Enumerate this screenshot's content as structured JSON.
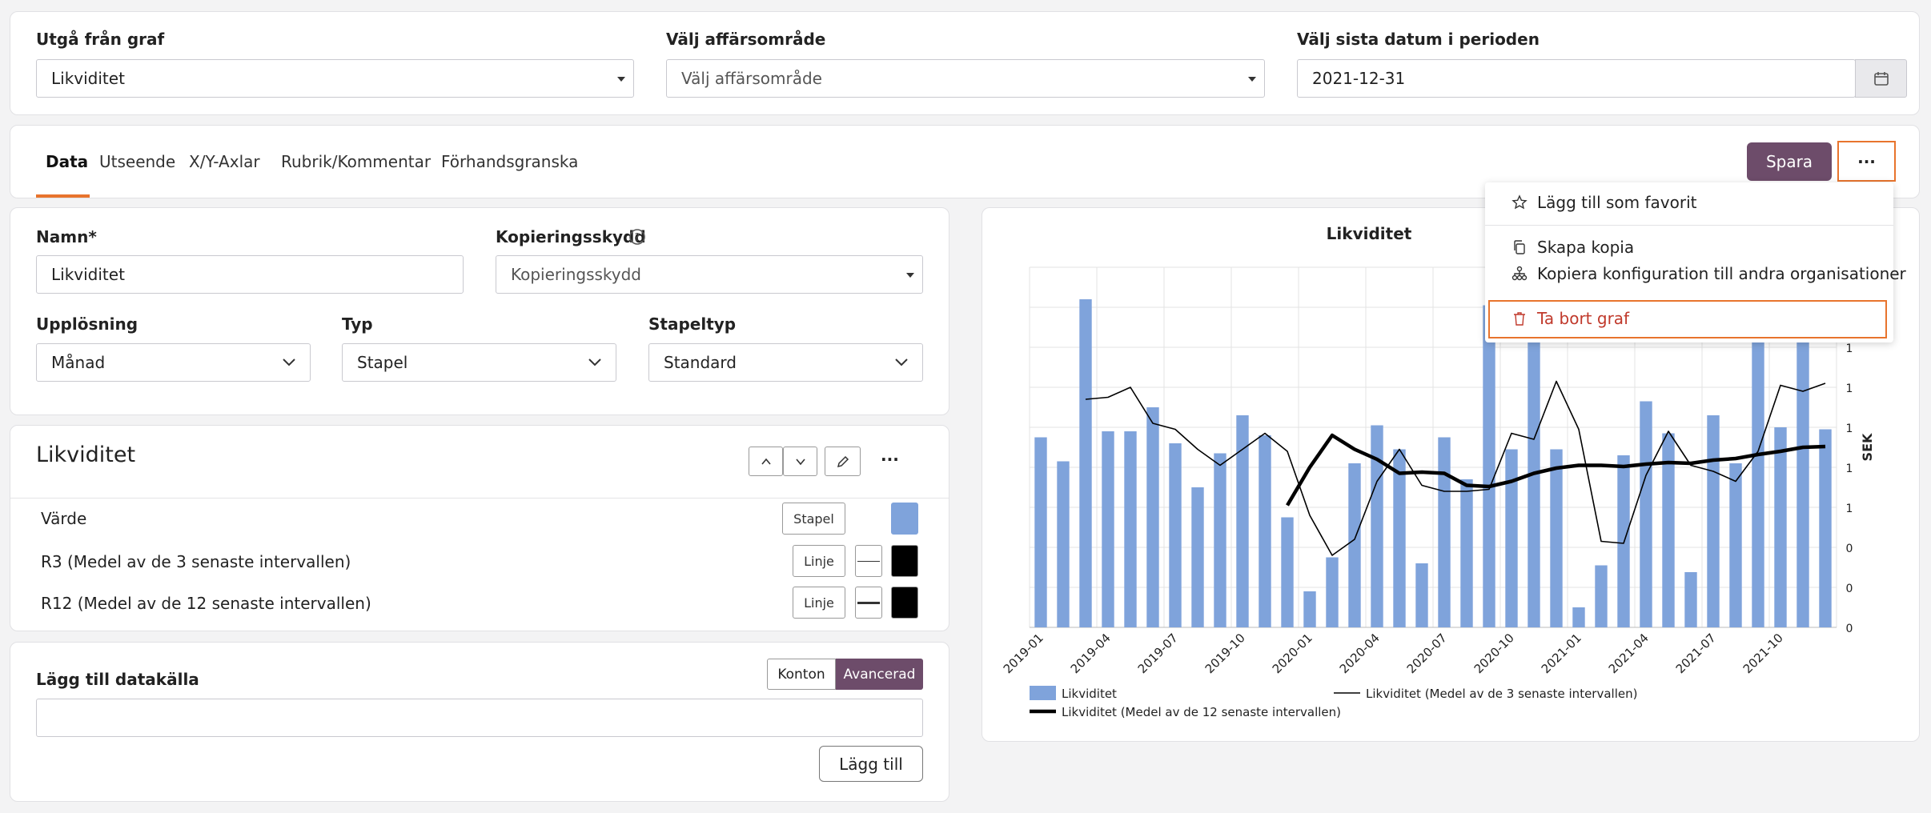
{
  "filters": {
    "source_graph": {
      "label": "Utgå från graf",
      "value": "Likviditet"
    },
    "business_area": {
      "label": "Välj affärsområde",
      "placeholder": "Välj affärsområde"
    },
    "end_date": {
      "label": "Välj sista datum i perioden",
      "value": "2021-12-31"
    }
  },
  "tabs": [
    "Data",
    "Utseende",
    "X/Y-Axlar",
    "Rubrik/Kommentar",
    "Förhandsgranska"
  ],
  "toolbar": {
    "save_label": "Spara",
    "more_label": "···"
  },
  "menu": {
    "favorite": "Lägg till som favorit",
    "copy": "Skapa kopia",
    "copy_config": "Kopiera konfiguration till andra organisationer",
    "delete": "Ta bort graf"
  },
  "form": {
    "name_label": "Namn*",
    "name_value": "Likviditet",
    "copy_protect_label": "Kopieringsskydd",
    "copy_protect_placeholder": "Kopieringsskydd",
    "resolution_label": "Upplösning",
    "resolution_value": "Månad",
    "type_label": "Typ",
    "type_value": "Stapel",
    "stack_label": "Stapeltyp",
    "stack_value": "Standard"
  },
  "series_panel": {
    "title": "Likviditet",
    "more_label": "···",
    "rows": [
      {
        "label": "Värde",
        "kind": "Stapel",
        "color": "#7fa3db"
      },
      {
        "label": "R3 (Medel av de 3 senaste intervallen)",
        "kind": "Linje",
        "color": "#000000"
      },
      {
        "label": "R12 (Medel av de 12 senaste intervallen)",
        "kind": "Linje",
        "color": "#000000"
      }
    ]
  },
  "datasource": {
    "label": "Lägg till datakälla",
    "toggle_a": "Konton",
    "toggle_b": "Avancerad",
    "add_label": "Lägg till"
  },
  "colors": {
    "accent": "#6d4c6a",
    "highlight": "#e8742d",
    "danger": "#c0392b",
    "bar": "#7fa3db"
  },
  "chart_data": {
    "type": "bar",
    "title": "Likviditet",
    "ylabel": "SEK",
    "x_tick_labels": [
      "2019-01",
      "2019-04",
      "2019-07",
      "2019-10",
      "2020-01",
      "2020-04",
      "2020-07",
      "2020-10",
      "2021-01",
      "2021-04",
      "2021-07",
      "2021-10"
    ],
    "y_tick_labels": [
      "0",
      "0",
      "0",
      "1",
      "1",
      "1",
      "1",
      "1",
      "1"
    ],
    "ylim": [
      0,
      9
    ],
    "grid": true,
    "legend_position": "bottom",
    "series": [
      {
        "name": "Likviditet",
        "kind": "bar",
        "values": [
          4.75,
          4.15,
          8.2,
          4.9,
          4.9,
          5.5,
          4.6,
          3.5,
          4.35,
          5.3,
          4.8,
          2.75,
          0.9,
          1.75,
          4.1,
          5.05,
          4.45,
          1.6,
          4.75,
          3.7,
          8.05,
          4.45,
          7.8,
          4.45,
          0.5,
          1.55,
          4.3,
          5.65,
          4.85,
          1.38,
          5.3,
          4.1,
          8.05,
          5.0,
          8.05,
          4.95
        ]
      },
      {
        "name": "Likviditet (Medel av de 3 senaste intervallen)",
        "kind": "line",
        "values": [
          null,
          null,
          5.7,
          5.75,
          6.0,
          5.1,
          4.95,
          4.45,
          4.05,
          4.45,
          4.85,
          4.4,
          2.8,
          1.8,
          2.2,
          3.65,
          4.45,
          3.55,
          3.4,
          3.4,
          3.45,
          4.85,
          4.7,
          6.15,
          4.95,
          2.15,
          2.1,
          3.8,
          4.9,
          4.05,
          3.9,
          3.65,
          4.4,
          6.05,
          5.9,
          6.1
        ]
      },
      {
        "name": "Likviditet (Medel av de 12 senaste intervallen)",
        "kind": "line",
        "values": [
          null,
          null,
          null,
          null,
          null,
          null,
          null,
          null,
          null,
          null,
          null,
          3.05,
          4.0,
          4.8,
          4.45,
          4.2,
          3.85,
          3.88,
          3.85,
          3.55,
          3.52,
          3.65,
          3.85,
          3.98,
          4.05,
          4.05,
          4.02,
          4.08,
          4.12,
          4.1,
          4.18,
          4.22,
          4.32,
          4.4,
          4.5,
          4.52
        ]
      }
    ]
  }
}
